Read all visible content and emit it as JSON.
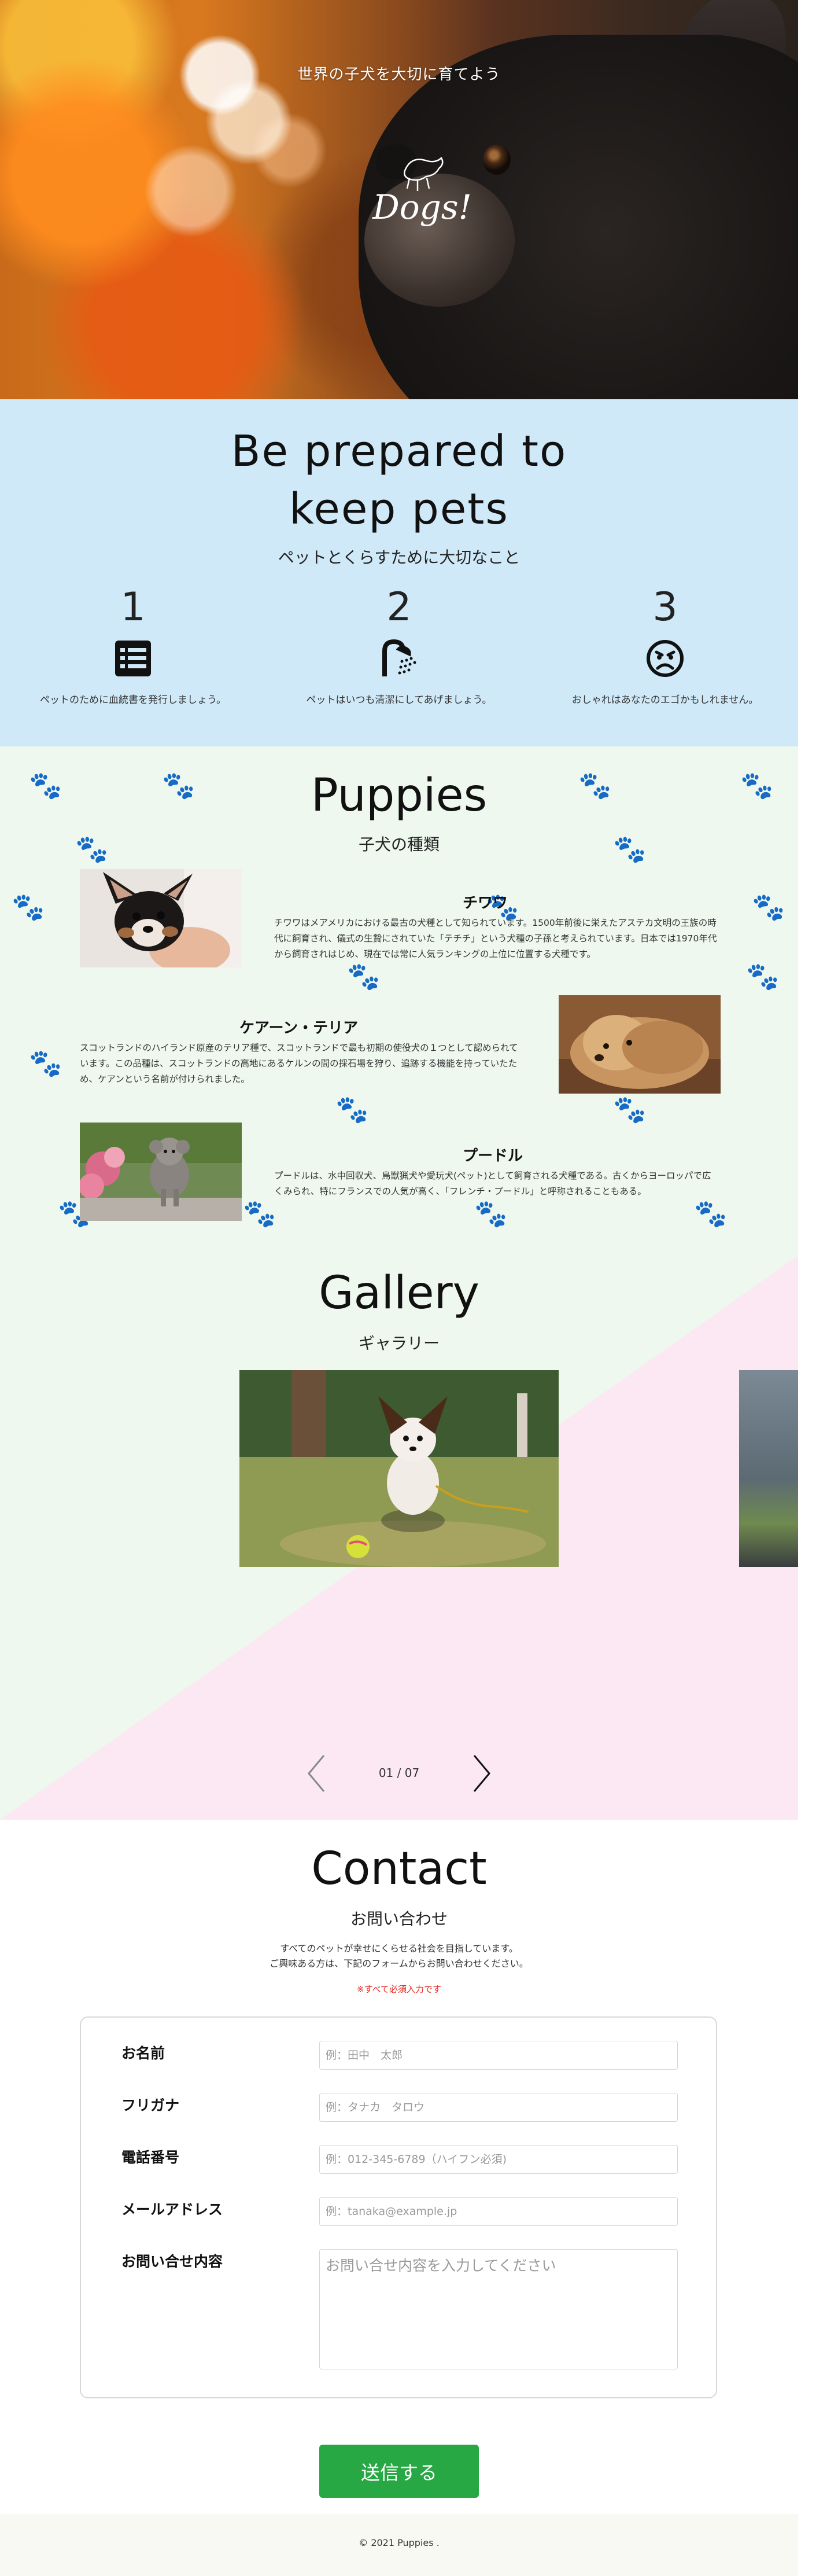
{
  "hero": {
    "tagline": "世界の子犬を大切に育てよう",
    "logo_text": "Dogs!",
    "logo_icon": "dog-silhouette-icon"
  },
  "prepared": {
    "title_line1": "Be prepared to",
    "title_line2": "keep pets",
    "subtitle": "ペットとくらすために大切なこと",
    "steps": [
      {
        "num": "1",
        "icon": "list-icon",
        "text": "ペットのために血統書を発行しましょう。"
      },
      {
        "num": "2",
        "icon": "shower-icon",
        "text": "ペットはいつも清潔にしてあげましょう。"
      },
      {
        "num": "3",
        "icon": "sad-face-icon",
        "text": "おしゃれはあなたのエゴかもしれません。"
      }
    ]
  },
  "puppies": {
    "title": "Puppies",
    "subtitle": "子犬の種類",
    "breeds": [
      {
        "name": "チワワ",
        "desc": "チワワはメアメリカにおける最古の犬種として知られています。1500年前後に栄えたアステカ文明の王族の時代に飼育され、儀式の生贄にされていた「テチチ」という犬種の子孫と考えられています。日本では1970年代から飼育されはじめ、現在では常に人気ランキングの上位に位置する犬種です。"
      },
      {
        "name": "ケアーン・テリア",
        "desc": "スコットランドのハイランド原産のテリア種で、スコットランドで最も初期の使役犬の１つとして認められています。この品種は、スコットランドの高地にあるケルンの間の採石場を狩り、追跡する機能を持っていたため、ケアンという名前が付けられました。"
      },
      {
        "name": "プードル",
        "desc": "プードルは、水中回収犬、鳥獣猟犬や愛玩犬(ペット)として飼育される犬種である。古くからヨーロッパで広くみられ、特にフランスでの人気が高く、「フレンチ・プードル」と呼称されることもある。"
      }
    ]
  },
  "gallery": {
    "title": "Gallery",
    "subtitle": "ギャラリー",
    "pager": "01 / 07",
    "prev_icon": "chevron-left-icon",
    "next_icon": "chevron-right-icon"
  },
  "contact": {
    "title": "Contact",
    "subtitle": "お問い合わせ",
    "intro_line1": "すべてのペットが幸せにくらせる社会を目指しています。",
    "intro_line2": "ご興味ある方は、下記のフォームからお問い合わせください。",
    "required_note": "※すべて必須入力です",
    "fields": [
      {
        "label": "お名前",
        "placeholder": "例：田中　太郎",
        "value": ""
      },
      {
        "label": "フリガナ",
        "placeholder": "例：タナカ　タロウ",
        "value": ""
      },
      {
        "label": "電話番号",
        "placeholder": "例：012-345-6789（ハイフン必須)",
        "value": ""
      },
      {
        "label": "メールアドレス",
        "placeholder": "例：tanaka@example.jp",
        "value": ""
      }
    ],
    "message": {
      "label": "お問い合せ内容",
      "placeholder": "お問い合せ内容を入力してください",
      "value": ""
    },
    "submit_label": "送信する"
  },
  "footer": {
    "copyright": "© 2021 Puppies ."
  },
  "colors": {
    "prepared_bg": "#cfe9f8",
    "puppies_bg": "#eef8ef",
    "gallery_pink": "#fbe8f2",
    "submit_green": "#28a745",
    "required_red": "#e8281f"
  }
}
